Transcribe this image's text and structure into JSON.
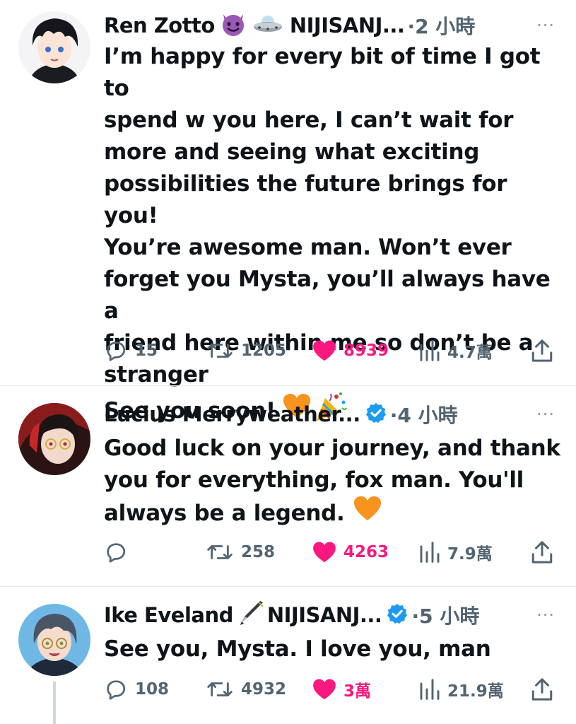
{
  "tweets": [
    {
      "author": "Ren Zotto",
      "handle_suffix": "NIJISANJ...",
      "time": "·2 小時",
      "more": "···",
      "lines": [
        "I’m happy for every bit of time I got to",
        "spend w you here, I can’t wait for",
        "more and seeing what exciting",
        "possibilities the future brings for you!",
        "You’re awesome man. Won’t ever",
        "forget you Mysta, you’ll always have a",
        "friend here within me so don’t be a",
        "stranger",
        "See you soon!"
      ],
      "replies": "15",
      "retweets": "1205",
      "likes": "8939",
      "views": "4.7萬"
    },
    {
      "author": "Lucius Merryweather...",
      "time": "·4 小時",
      "more": "···",
      "lines": [
        "Good luck on your journey, and thank",
        "you for everything, fox man. You'll",
        "always be a legend."
      ],
      "replies": "",
      "retweets": "258",
      "likes": "4263",
      "views": "7.9萬"
    },
    {
      "author": "Ike Eveland",
      "handle_suffix": "NIJISANJ...",
      "time": "·5 小時",
      "more": "···",
      "lines": [
        "See you, Mysta. I love you, man"
      ],
      "replies": "108",
      "retweets": "4932",
      "likes": "3萬",
      "views": "21.9萬"
    }
  ],
  "icons": {
    "reply": "reply-icon",
    "retweet": "retweet-icon",
    "like": "heart-icon",
    "views": "views-icon",
    "share": "share-icon",
    "verified": "verified-badge-icon",
    "more": "more-icon"
  },
  "colors": {
    "like_active": "#f91880",
    "verified": "#1d9bf0",
    "secondary_text": "#536471",
    "divider": "#e6e8ea"
  }
}
